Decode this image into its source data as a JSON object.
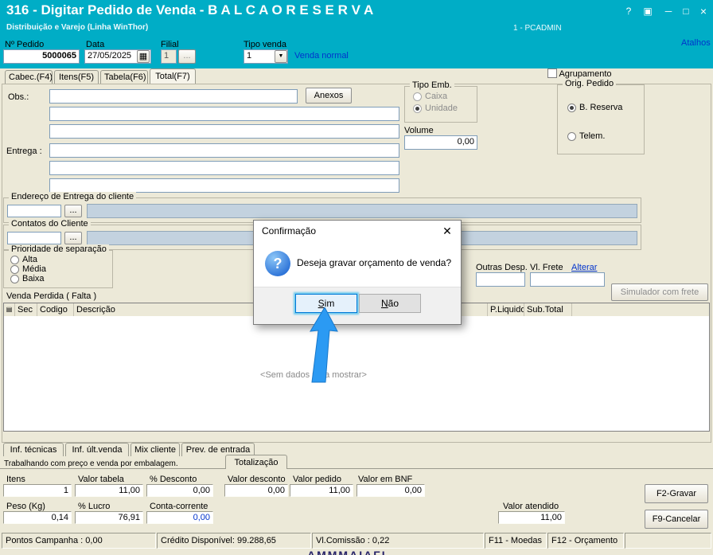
{
  "window": {
    "title": "316 - Digitar Pedido de Venda - B A L C A O  R E S E R V A",
    "subtitle": "Distribuição e Varejo (Linha WinThor)",
    "session": "1 - PCADMIN",
    "controls": {
      "help": "?",
      "capture": "▣",
      "minimize": "─",
      "maximize": "□",
      "close": "×"
    }
  },
  "shortcuts_link": "Atalhos",
  "order_header": {
    "pedido": {
      "label": "Nº Pedido",
      "value": "5000065"
    },
    "data": {
      "label": "Data",
      "value": "27/05/2025"
    },
    "filial": {
      "label": "Filial",
      "value": "1",
      "browse": "..."
    },
    "tipo_venda": {
      "label": "Tipo venda",
      "value": "1",
      "description": "Venda normal"
    }
  },
  "tabs": {
    "items": [
      "Cabec.(F4)",
      "Itens(F5)",
      "Tabela(F6)",
      "Total(F7)"
    ],
    "active": "Total(F7)"
  },
  "agrupamento_label": "Agrupamento",
  "form": {
    "obs_label": "Obs.:",
    "anexos_button": "Anexos",
    "entrega_label": "Entrega :",
    "tipo_emb": {
      "legend": "Tipo Emb.",
      "caixa": "Caixa",
      "unidade": "Unidade",
      "selected": "Unidade"
    },
    "volume": {
      "label": "Volume",
      "value": "0,00"
    },
    "orig_pedido": {
      "legend": "Orig. Pedido",
      "b_reserva": "B. Reserva",
      "telem": "Telem.",
      "selected": "B. Reserva"
    },
    "endereco_legend": "Endereço de Entrega do cliente",
    "contatos_legend": "Contatos do Cliente",
    "browse": "...",
    "prioridade": {
      "legend": "Prioridade de separação",
      "alta": "Alta",
      "media": "Média",
      "baixa": "Baixa"
    },
    "outras_desp_label": "Outras Desp.",
    "vl_frete_label": "Vl. Frete",
    "alterar_link": "Alterar",
    "simulador_button": "Simulador com frete",
    "venda_perdida_label": "Venda Perdida ( Falta )"
  },
  "grid": {
    "columns": {
      "marker": "▤",
      "sec": "Sec",
      "codigo": "Codigo",
      "descricao": "Descrição",
      "p_liquido": "P.Liquido",
      "sub_total": "Sub.Total"
    },
    "empty_text": "<Sem dados para mostrar>"
  },
  "dialog": {
    "title": "Confirmação",
    "close": "✕",
    "icon": "?",
    "message": "Deseja gravar orçamento de venda?",
    "yes_button": "Sim",
    "no_button": "Não"
  },
  "info_tabs": [
    "Inf. técnicas",
    "Inf. últ.venda",
    "Mix cliente",
    "Prev. de entrada"
  ],
  "totals": {
    "note": "Trabalhando com preço e venda por embalagem.",
    "tab": "Totalização",
    "itens": {
      "label": "Itens",
      "value": "1"
    },
    "valor_tabela": {
      "label": "Valor tabela",
      "value": "11,00"
    },
    "pct_desconto": {
      "label": "% Desconto",
      "value": "0,00"
    },
    "valor_desconto": {
      "label": "Valor desconto",
      "value": "0,00"
    },
    "valor_pedido": {
      "label": "Valor pedido",
      "value": "11,00"
    },
    "valor_bnf": {
      "label": "Valor em BNF",
      "value": "0,00"
    },
    "peso": {
      "label": "Peso (Kg)",
      "value": "0,14"
    },
    "pct_lucro": {
      "label": "% Lucro",
      "value": "76,91"
    },
    "conta_corrente": {
      "label": "Conta-corrente",
      "value": "0,00"
    },
    "valor_atendido": {
      "label": "Valor atendido",
      "value": "11,00"
    },
    "gravar_button": "F2-Gravar",
    "cancelar_button": "F9-Cancelar"
  },
  "statusbar": {
    "pontos": "Pontos Campanha : 0,00",
    "credito": "Crédito Disponível: 99.288,65",
    "comissao": "Vl.Comissão : 0,22",
    "moedas": "F11 - Moedas",
    "orcamento": "F12 - Orçamento"
  },
  "icons": {
    "calendar": "▦",
    "dropdown": "▼"
  },
  "misc": {
    "clipped_text": "AMMMAIAFI"
  },
  "colors": {
    "titlebar": "#00ADC6",
    "accent_blue": "#0033CC",
    "arrow": "#2B9AF3"
  }
}
